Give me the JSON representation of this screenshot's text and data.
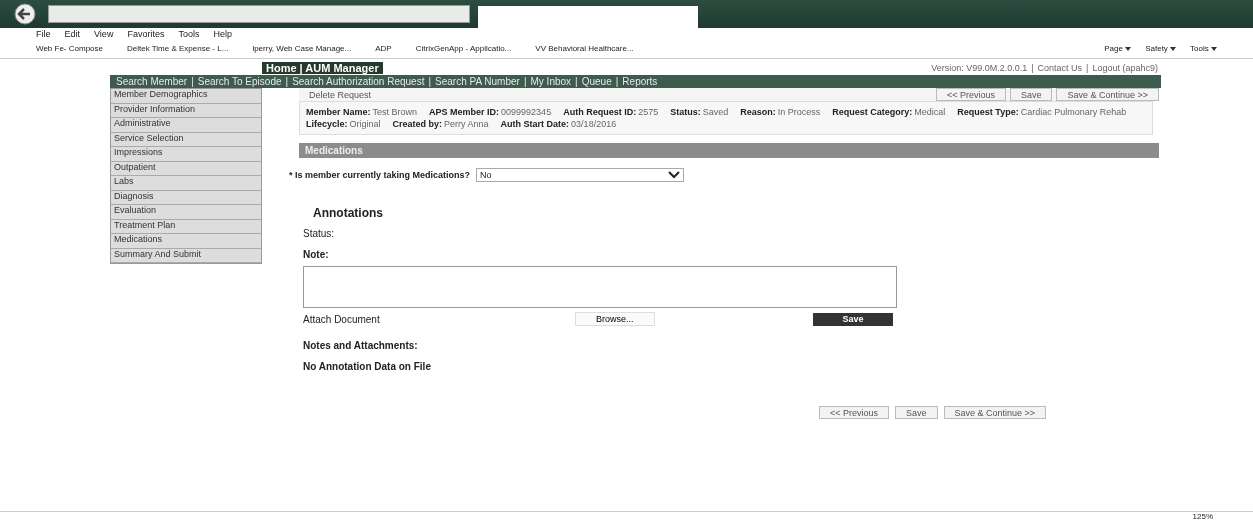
{
  "browser": {
    "menu": [
      "File",
      "Edit",
      "View",
      "Favorites",
      "Tools",
      "Help"
    ],
    "favorites": [
      "Web Fe- Compose",
      "Deltek Time & Expense - L...",
      "lperry, Web Case Manage...",
      "ADP",
      "CitrixGenApp - Applicatio...",
      "VV Behavioral Healthcare..."
    ],
    "commands": [
      "Page",
      "Safety",
      "Tools"
    ],
    "zoom": "125%"
  },
  "header": {
    "app_title": "Home | AUM Manager",
    "version": "Version: V99.0M.2.0.0.1",
    "separator": "|",
    "links": [
      "Contact Us",
      "Logout (apahc9)"
    ]
  },
  "nav": {
    "separator": "|",
    "items": [
      "Search Member",
      "Search To Episode",
      "Search Authorization Request",
      "Search PA Number",
      "My Inbox",
      "Queue",
      "Reports"
    ]
  },
  "sidebar": {
    "items": [
      "Member Demographics",
      "Provider Information",
      "Administrative",
      "Service Selection",
      "Impressions",
      "Outpatient",
      "Labs",
      "Diagnosis",
      "Evaluation",
      "Treatment Plan",
      "Medications",
      "Summary And Submit"
    ]
  },
  "toolbar": {
    "delete": "Delete Request",
    "buttons": [
      "<< Previous",
      "Save",
      "Save & Continue >>"
    ]
  },
  "summary": [
    {
      "label": "Member Name:",
      "value": "Test Brown"
    },
    {
      "label": "APS Member ID:",
      "value": "0099992345"
    },
    {
      "label": "Auth Request ID:",
      "value": "2575"
    },
    {
      "label": "Status:",
      "value": "Saved"
    },
    {
      "label": "Reason:",
      "value": "In Process"
    },
    {
      "label": "Request Category:",
      "value": "Medical"
    },
    {
      "label": "Request Type:",
      "value": "Cardiac Pulmonary Rehab"
    },
    {
      "label": "Lifecycle:",
      "value": "Original"
    },
    {
      "label": "Created by:",
      "value": "Perry Anna"
    },
    {
      "label": "Auth Start Date:",
      "value": "03/18/2016"
    }
  ],
  "section": "Medications",
  "question": {
    "required": "*",
    "label": "Is member currently taking Medications?",
    "value": "No"
  },
  "annotations": {
    "title": "Annotations",
    "status_label": "Status:",
    "note_label": "Note:",
    "attach_label": "Attach Document",
    "browse": "Browse...",
    "save": "Save",
    "list_title": "Notes and Attachments:",
    "empty": "No Annotation Data on File"
  },
  "footer_buttons": [
    "<< Previous",
    "Save",
    "Save & Continue >>"
  ]
}
